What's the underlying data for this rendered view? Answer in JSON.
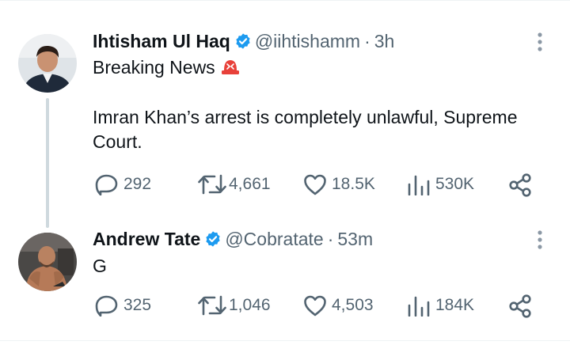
{
  "tweets": [
    {
      "author_name": "Ihtisham Ul Haq",
      "handle": "@iihtishamm",
      "time": "3h",
      "lines": [
        "Breaking News",
        "",
        "Imran Khan’s arrest is completely unlawful, Supreme",
        "Court."
      ],
      "stats": {
        "replies": "292",
        "retweets": "4,661",
        "likes": "18.5K",
        "views": "530K"
      }
    },
    {
      "author_name": "Andrew Tate",
      "handle": "@Cobratate",
      "time": "53m",
      "lines": [
        "G"
      ],
      "stats": {
        "replies": "325",
        "retweets": "1,046",
        "likes": "4,503",
        "views": "184K"
      }
    }
  ],
  "separator": "·",
  "icons": {
    "verified": "verified-badge-icon",
    "siren": "police-siren-emoji",
    "reply": "reply-icon",
    "retweet": "retweet-icon",
    "like": "heart-icon",
    "views": "views-chart-icon",
    "share": "share-icon",
    "more": "more-dots-icon"
  },
  "colors": {
    "text": "#0f1419",
    "secondary": "#536471",
    "verified": "#1d9bf0",
    "thread_line": "#cfd9de",
    "divider": "#eff3f4"
  }
}
